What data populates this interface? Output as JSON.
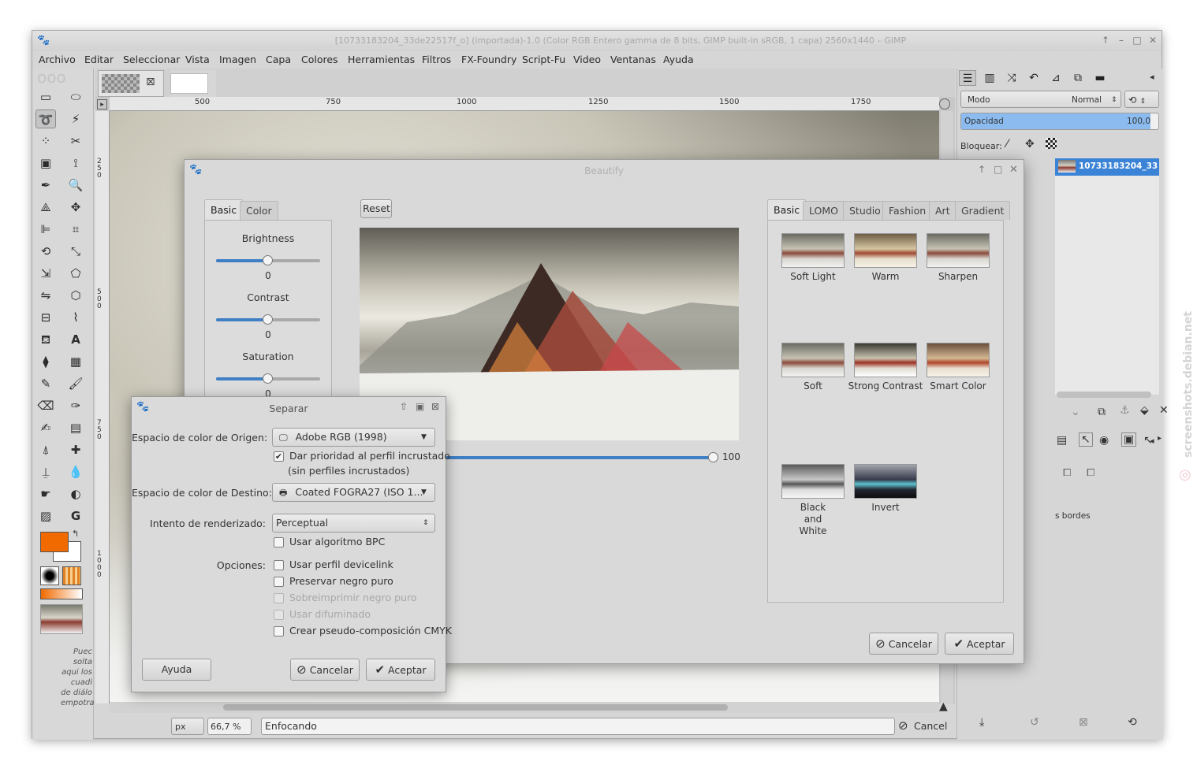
{
  "window": {
    "title": "[10733183204_33de22517f_o] (importada)-1.0 (Color RGB Entero gamma de 8 bits, GIMP built-in sRGB, 1 capa) 2560x1440 – GIMP"
  },
  "menu": [
    "Archivo",
    "Editar",
    "Seleccionar",
    "Vista",
    "Imagen",
    "Capa",
    "Colores",
    "Herramientas",
    "Filtros",
    "FX-Foundry",
    "Script-Fu",
    "Video",
    "Ventanas",
    "Ayuda"
  ],
  "ruler": {
    "h_labels": [
      "500",
      "750",
      "1000",
      "1250",
      "1500",
      "1750"
    ],
    "v_labels": [
      "250",
      "500",
      "750",
      "1000"
    ]
  },
  "toolbox": {
    "hint_text": "Puec solta aqui los cuadi de diálo empotra"
  },
  "statusbar": {
    "unit": "px",
    "zoom": "66,7 %",
    "message": "Enfocando",
    "cancel_label": "Cancel"
  },
  "dock": {
    "mode_label": "Modo",
    "mode_value": "Normal",
    "opacity_label": "Opacidad",
    "opacity_value": "100,0",
    "lock_label": "Bloquear:",
    "layer_name": "10733183204_33de22517f_o.",
    "bordes_text": "s bordes"
  },
  "beautify": {
    "title": "Beautify",
    "left_tabs": [
      "Basic",
      "Color"
    ],
    "reset_label": "Reset",
    "sliders": [
      {
        "label": "Brightness",
        "value": "0",
        "fraction": 0.5
      },
      {
        "label": "Contrast",
        "value": "0",
        "fraction": 0.5
      },
      {
        "label": "Saturation",
        "value": "0",
        "fraction": 0.5
      }
    ],
    "strength": {
      "value": "100",
      "fraction": 1.0
    },
    "right_tabs": [
      "Basic",
      "LOMO",
      "Studio",
      "Fashion",
      "Art",
      "Gradient"
    ],
    "presets": [
      "Soft Light",
      "Warm",
      "Sharpen",
      "Soft",
      "Strong Contrast",
      "Smart Color",
      "Black and White",
      "Invert"
    ],
    "cancel_label": "Cancelar",
    "ok_label": "Aceptar"
  },
  "separar": {
    "title": "Separar",
    "source_label": "Espacio de color de Origen:",
    "source_value": "Adobe RGB (1998)",
    "priority_label": "Dar prioridad al perfil incrustado",
    "priority_checked": true,
    "no_profiles_note": "(sin perfiles incrustados)",
    "dest_label": "Espacio de color de Destino:",
    "dest_value": "Coated FOGRA27 (ISO 1...",
    "intent_label": "Intento de renderizado:",
    "intent_value": "Perceptual",
    "bpc_label": "Usar algoritmo BPC",
    "options_label": "Opciones:",
    "options": [
      {
        "label": "Usar perfil devicelink",
        "enabled": true
      },
      {
        "label": "Preservar negro puro",
        "enabled": true
      },
      {
        "label": "Sobreimprimir negro puro",
        "enabled": false
      },
      {
        "label": "Usar difuminado",
        "enabled": false
      },
      {
        "label": "Crear pseudo-composición CMYK",
        "enabled": true
      }
    ],
    "help_label": "Ayuda",
    "cancel_label": "Cancelar",
    "ok_label": "Aceptar"
  },
  "watermark": "screenshots.debian.net",
  "colors": {
    "foreground": "#f06a00",
    "background": "#ffffff",
    "accent": "#3f7fc5",
    "selection": "#3a83d6"
  }
}
